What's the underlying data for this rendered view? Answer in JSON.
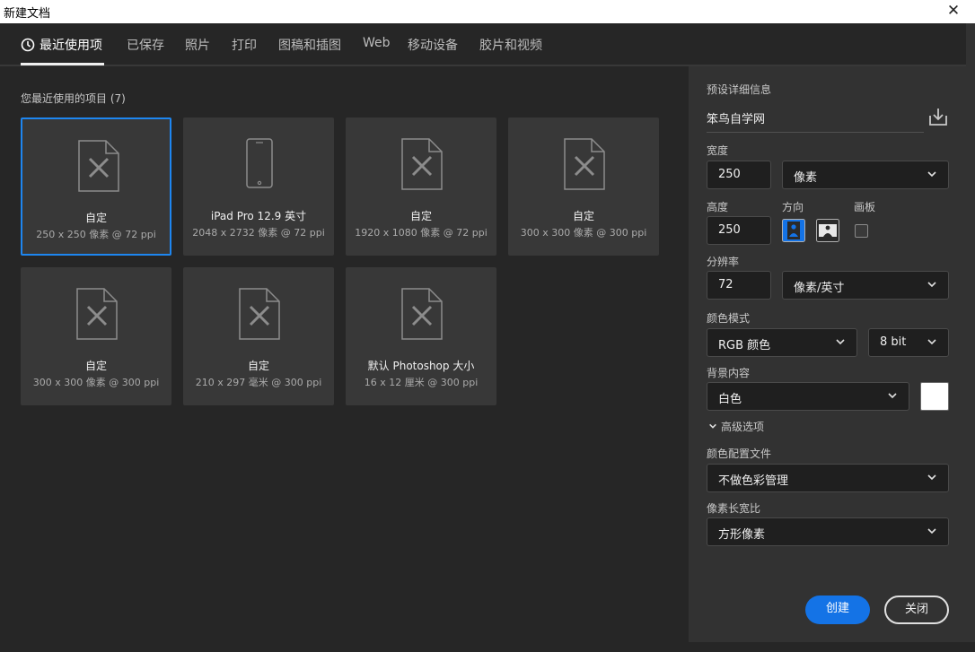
{
  "window": {
    "title": "新建文档",
    "close": "✕"
  },
  "tabs": [
    {
      "label": "最近使用项"
    },
    {
      "label": "已保存"
    },
    {
      "label": "照片"
    },
    {
      "label": "打印"
    },
    {
      "label": "图稿和插图"
    },
    {
      "label": "Web"
    },
    {
      "label": "移动设备"
    },
    {
      "label": "胶片和视频"
    }
  ],
  "recent": {
    "label": "您最近使用的项目 (7)",
    "items": [
      {
        "name": "自定",
        "spec": "250 x 250 像素 @ 72 ppi",
        "icon": "document-icon"
      },
      {
        "name": "iPad Pro 12.9 英寸",
        "spec": "2048 x 2732 像素 @ 72 ppi",
        "icon": "tablet-icon"
      },
      {
        "name": "自定",
        "spec": "1920 x 1080 像素 @ 72 ppi",
        "icon": "document-icon"
      },
      {
        "name": "自定",
        "spec": "300 x 300 像素 @ 300 ppi",
        "icon": "document-icon"
      },
      {
        "name": "自定",
        "spec": "300 x 300 像素 @ 300 ppi",
        "icon": "document-icon"
      },
      {
        "name": "自定",
        "spec": "210 x 297 毫米 @ 300 ppi",
        "icon": "document-icon"
      },
      {
        "name": "默认 Photoshop 大小",
        "spec": "16 x 12 厘米 @ 300 ppi",
        "icon": "document-icon"
      }
    ]
  },
  "details": {
    "header": "预设详细信息",
    "preset_name": "笨鸟自学网",
    "width_label": "宽度",
    "width_value": "250",
    "width_unit": "像素",
    "height_label": "高度",
    "height_value": "250",
    "orientation_label": "方向",
    "artboard_label": "画板",
    "resolution_label": "分辨率",
    "resolution_value": "72",
    "resolution_unit": "像素/英寸",
    "color_mode_label": "颜色模式",
    "color_mode": "RGB 颜色",
    "bit_depth": "8 bit",
    "background_label": "背景内容",
    "background": "白色",
    "background_color": "#ffffff",
    "advanced_label": "高级选项",
    "color_profile_label": "颜色配置文件",
    "color_profile": "不做色彩管理",
    "pixel_aspect_label": "像素长宽比",
    "pixel_aspect": "方形像素",
    "create_button": "创建",
    "close_button": "关闭"
  },
  "colors": {
    "accent": "#1473e6",
    "selected_border": "#1e86f0",
    "background": "#262626",
    "panel": "#323232",
    "card": "#383838"
  }
}
